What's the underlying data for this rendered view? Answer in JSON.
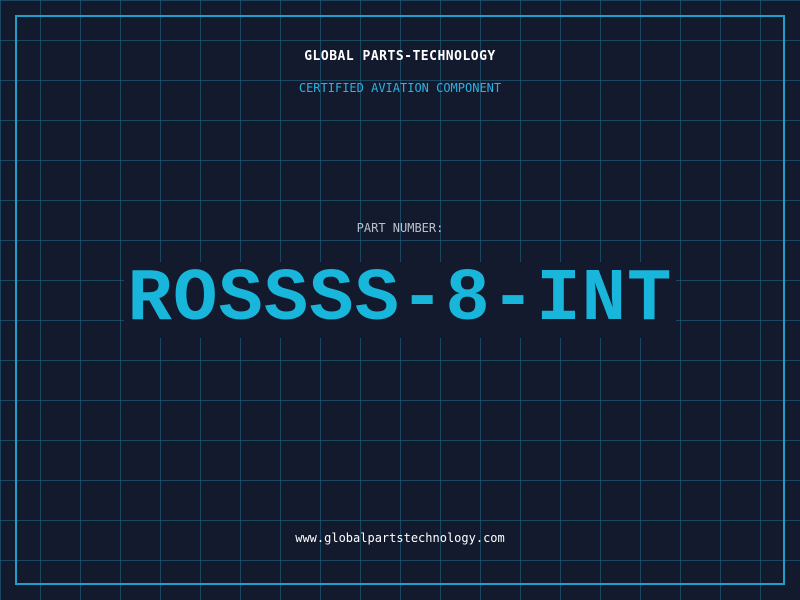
{
  "header": {
    "company_name": "GLOBAL PARTS-TECHNOLOGY",
    "subtitle": "CERTIFIED AVIATION COMPONENT"
  },
  "part": {
    "label": "PART NUMBER:",
    "number": "ROSSSS-8-INT"
  },
  "footer": {
    "website": "www.globalpartstechnology.com"
  },
  "colors": {
    "background": "#131a2e",
    "grid": "#1e6e8c",
    "frame": "#1f9fc8",
    "accent": "#18b6da",
    "subtitle": "#2bb3e0"
  }
}
